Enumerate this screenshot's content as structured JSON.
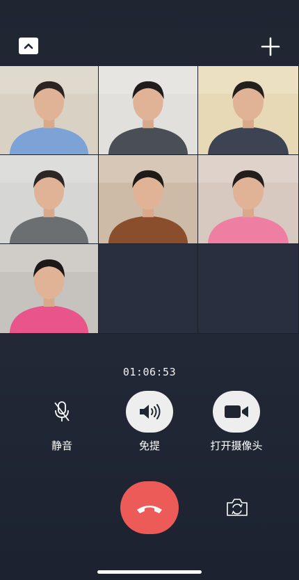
{
  "header": {
    "collapse_icon": "chevron-up-icon",
    "add_icon": "plus-icon"
  },
  "participants": [
    {
      "bg": "#d9d2c4",
      "shirt": "#7da3d6",
      "hair": "#2a2422"
    },
    {
      "bg": "#e2e0dc",
      "shirt": "#4a4f56",
      "hair": "#1f1c1b"
    },
    {
      "bg": "#e7d9b5",
      "shirt": "#3c4352",
      "hair": "#231f1d"
    },
    {
      "bg": "#d6d6d4",
      "shirt": "#6c6f72",
      "hair": "#2b2725"
    },
    {
      "bg": "#cdbba7",
      "shirt": "#8a4e2d",
      "hair": "#1d1a18"
    },
    {
      "bg": "#d8c9c0",
      "shirt": "#ee7fa2",
      "hair": "#231d1c"
    },
    {
      "bg": "#c6c2bd",
      "shirt": "#e9548a",
      "hair": "#1b1818"
    }
  ],
  "call": {
    "duration": "01:06:53"
  },
  "controls": {
    "mute_label": "静音",
    "speaker_label": "免提",
    "camera_label": "打开摄像头"
  },
  "colors": {
    "hangup": "#ec5b57",
    "button_fill": "#eeeeee",
    "background": "#1f2531"
  }
}
